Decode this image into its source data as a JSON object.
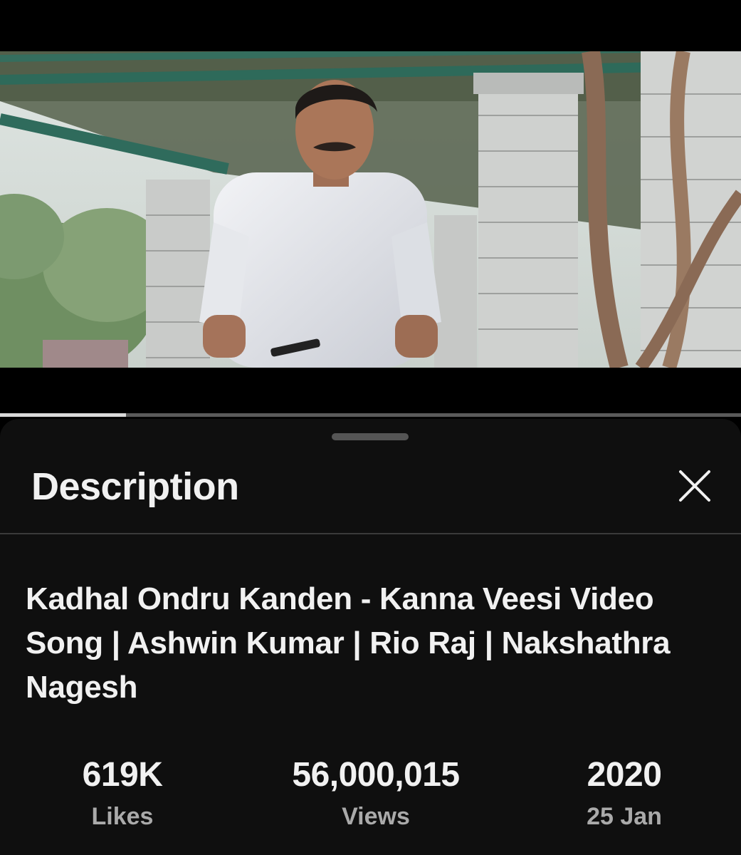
{
  "player": {
    "progress_fraction": 0.17
  },
  "description_sheet": {
    "title": "Description",
    "close_icon": "close-icon",
    "video_title": "Kadhal Ondru Kanden - Kanna Veesi Video Song | Ashwin Kumar | Rio Raj | Nakshathra Nagesh",
    "stats": {
      "likes": {
        "value": "619K",
        "label": "Likes"
      },
      "views": {
        "value": "56,000,015",
        "label": "Views"
      },
      "date": {
        "value": "2020",
        "label": "25 Jan"
      }
    }
  },
  "colors": {
    "sheet_background": "#0f0f0f",
    "text_primary": "#f1f1f1",
    "text_secondary": "#aaaaaa"
  }
}
